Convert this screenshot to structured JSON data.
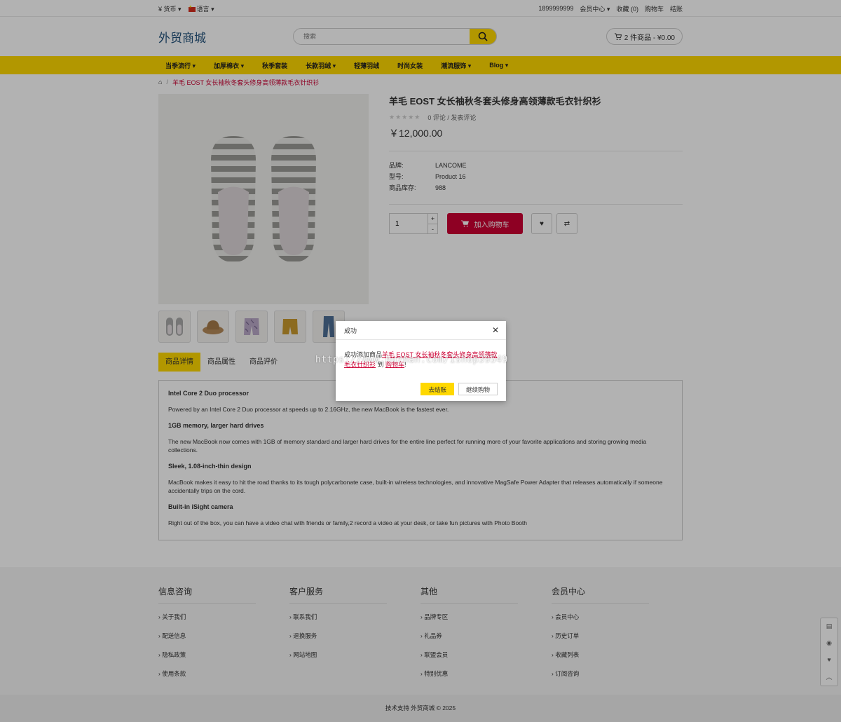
{
  "topbar": {
    "currency": "¥ 货币",
    "language": "语言",
    "phone": "1899999999",
    "member": "会员中心",
    "wishlist": "收藏 (0)",
    "cart": "购物车",
    "checkout": "结账"
  },
  "header": {
    "logo": "外贸商城",
    "search_placeholder": "搜索",
    "cart_summary": "2 件商品 - ¥0.00"
  },
  "nav": [
    "当季流行",
    "加厚棉衣",
    "秋季套装",
    "长款羽绒",
    "轻薄羽绒",
    "时尚女装",
    "潮流服饰",
    "Blog"
  ],
  "breadcrumb": {
    "current": "羊毛 EOST 女长袖秋冬套头修身高领薄款毛衣针织衫"
  },
  "product": {
    "title": "羊毛 EOST 女长袖秋冬套头修身高领薄款毛衣针织衫",
    "reviews": "0 评论 / 发表评论",
    "price": "￥12,000.00",
    "attrs": [
      {
        "k": "品牌:",
        "v": "LANCOME"
      },
      {
        "k": "型号:",
        "v": "Product 16"
      },
      {
        "k": "商品库存:",
        "v": "988"
      }
    ],
    "qty": "1",
    "add_to_cart": "加入购物车"
  },
  "tabs": [
    "商品详情",
    "商品属性",
    "商品评价"
  ],
  "description": [
    {
      "h": "Intel Core 2 Duo processor",
      "p": "Powered by an Intel Core 2 Duo processor at speeds up to 2.16GHz, the new MacBook is the fastest ever."
    },
    {
      "h": "1GB memory, larger hard drives",
      "p": "The new MacBook now comes with 1GB of memory standard and larger hard drives for the entire line perfect for running more of your favorite applications and storing growing media collections."
    },
    {
      "h": "Sleek, 1.08-inch-thin design",
      "p": "MacBook makes it easy to hit the road thanks to its tough polycarbonate case, built-in wireless technologies, and innovative MagSafe Power Adapter that releases automatically if someone accidentally trips on the cord."
    },
    {
      "h": "Built-in iSight camera",
      "p": "Right out of the box, you can have a video chat with friends or family,2 record a video at your desk, or take fun pictures with Photo Booth"
    }
  ],
  "footer": {
    "cols": [
      {
        "title": "信息咨询",
        "items": [
          "关于我们",
          "配送信息",
          "隐私政策",
          "使用条款"
        ]
      },
      {
        "title": "客户服务",
        "items": [
          "联系我们",
          "退换服务",
          "网站地图"
        ]
      },
      {
        "title": "其他",
        "items": [
          "品牌专区",
          "礼品券",
          "联盟会员",
          "特别优惠"
        ]
      },
      {
        "title": "会员中心",
        "items": [
          "会员中心",
          "历史订单",
          "收藏列表",
          "订阅咨询"
        ]
      }
    ],
    "copyright": "技术支持 外贸商城 © 2025"
  },
  "modal": {
    "title": "成功",
    "prefix": "成功添加商品",
    "product_link": "羊毛 EOST 女长袖秋冬套头修身高领薄款毛衣针织衫",
    "middle": " 到 ",
    "cart_link": "购物车",
    "suffix": "!",
    "checkout": "去结账",
    "continue": "继续购物"
  },
  "watermark": "https://www.huzhan.com/1shop39549"
}
